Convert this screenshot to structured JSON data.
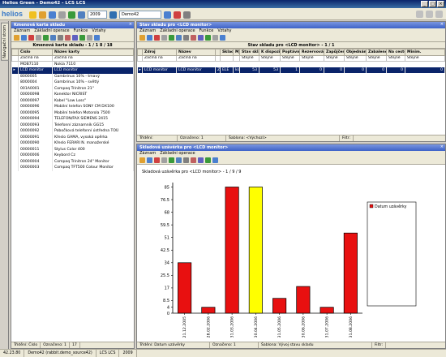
{
  "app": {
    "title": "Helios Green - Demo42 - LCS LCS"
  },
  "toolbar": {
    "logo": "helios",
    "year": "2009",
    "db": "Demo42"
  },
  "left_tab": {
    "label": "Navigační strom"
  },
  "left_panel": {
    "title": "Kmenová karta skladu",
    "menu": [
      "Záznam",
      "Základní operace",
      "Funkce",
      "Vztahy"
    ],
    "header": "Kmenová karta skladu - 1 / 1 8 / 18",
    "columns": [
      "Číslo",
      "Název karty"
    ],
    "filter": [
      "Začíná na",
      "Začíná na"
    ],
    "rows": [
      [
        "MOB7110",
        "Nokia 7110"
      ],
      [
        "LCD monitor",
        "LCD monitor"
      ],
      [
        "8000005",
        "Gambrinus 10% - tmavý"
      ],
      [
        "8000004",
        "Gambrinus 10% - světlý"
      ],
      [
        "001A0001",
        "Compaq Trinitron 21\""
      ],
      [
        "00000098",
        "Konektor NICRIST"
      ],
      [
        "00000097",
        "Kabel \"Low Loss\""
      ],
      [
        "00000096",
        "Mobilní telefon SONY CM DX100"
      ],
      [
        "00000095",
        "Mobilní telefon Motorola 7500"
      ],
      [
        "00000094",
        "TELEFON/FAX SIEMENS 2415"
      ],
      [
        "00000093",
        "Telefonní záznamník GG15"
      ],
      [
        "00000092",
        "Pobočková telefonní ústředna TOÚ"
      ],
      [
        "00000091",
        "Křeslo GAMA, vysoká opěrka"
      ],
      [
        "00000090",
        "Křeslo FERARI N. manažerské"
      ],
      [
        "00000011",
        "Stylus Color 400"
      ],
      [
        "00000006",
        "Keybord Cz"
      ],
      [
        "00000004",
        "Compaq Trinitron 24\" Monitor"
      ],
      [
        "00000003",
        "Compaq TFT500 Colour Monitor"
      ]
    ],
    "selected_index": 1,
    "status": [
      "Třídění: Číslo",
      "Označeno: 1",
      "17"
    ]
  },
  "stock_panel": {
    "title": "Stav skladu pro <LCD monitor>",
    "menu": [
      "Záznam",
      "Základní operace",
      "Funkce",
      "Vztahy"
    ],
    "header": "Stav skladu pro <LCD monitor> - 1 / 1",
    "columns": [
      "Zdroj",
      "Název",
      "",
      "Sklad",
      "MJ",
      "Stav skladu",
      "K dispozici",
      "Poptávno",
      "Rezervováno",
      "Zapůjčeno",
      "Objednáno",
      "Zabaleno",
      "Na cestě",
      "Minim."
    ],
    "filter": [
      "Začíná na",
      "Začíná na",
      "",
      "",
      "",
      "Stejné",
      "Stejné",
      "Stejné",
      "Stejné",
      "Stejné",
      "Stejné",
      "Stejné",
      "Stejné",
      "Stejné"
    ],
    "row": [
      "LCD monitor",
      "LCD monitor",
      "Z",
      "ELE",
      "ks",
      "53",
      "53",
      "1",
      "0",
      "0",
      "0",
      "0",
      "0",
      "0"
    ],
    "status": [
      "Třídění:",
      "Označeno: 1",
      "Šablona: <Výchozí>",
      "Filtr:"
    ]
  },
  "chart_panel": {
    "title": "Skladová uzávěrka pro <LCD monitor>",
    "menu": [
      "Záznam",
      "Základní operace"
    ],
    "status": [
      "Třídění: Datum uzávěrky",
      "Označeno: 1",
      "Šablona: Vývoj stavu skladu",
      "Filtr:"
    ]
  },
  "chart_data": {
    "type": "bar",
    "title": "Skladová uzávěrka pro <LCD monitor> - 1 / 9 / 9",
    "categories": [
      "21.12.2005",
      "28.02.2006",
      "31.03.2006",
      "30.04.2006",
      "31.05.2006",
      "30.06.2006",
      "31.07.2006",
      "31.08.2006"
    ],
    "values": [
      34,
      4,
      85,
      85,
      10,
      18,
      4,
      54
    ],
    "highlight_index": 3,
    "colors": {
      "bar": "#e81010",
      "highlight": "#ffff00"
    },
    "yticks": [
      "0",
      "4",
      "8.5",
      "17",
      "25.5",
      "34",
      "42.5",
      "51",
      "59.5",
      "68",
      "76.5",
      "85"
    ],
    "ylim": [
      0,
      88
    ],
    "legend": "Datum uzávěrky",
    "legend_position": "top-right"
  },
  "bottom_bar": [
    "42.23.80",
    "Demo42 (rabbit.demo_source42)",
    "LCS LCS",
    "2009"
  ]
}
